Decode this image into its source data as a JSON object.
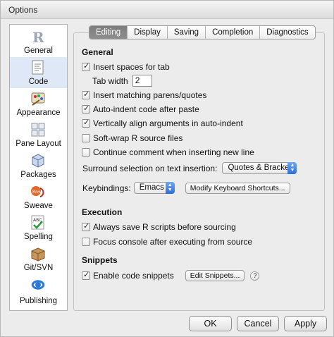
{
  "window": {
    "title": "Options"
  },
  "sidebar": {
    "items": [
      {
        "label": "General",
        "icon": "r-logo-icon"
      },
      {
        "label": "Code",
        "icon": "code-document-icon"
      },
      {
        "label": "Appearance",
        "icon": "paint-palette-icon"
      },
      {
        "label": "Pane Layout",
        "icon": "pane-layout-icon"
      },
      {
        "label": "Packages",
        "icon": "packages-icon"
      },
      {
        "label": "Sweave",
        "icon": "sweave-pdf-icon"
      },
      {
        "label": "Spelling",
        "icon": "spellcheck-abc-icon"
      },
      {
        "label": "Git/SVN",
        "icon": "git-box-icon"
      },
      {
        "label": "Publishing",
        "icon": "publishing-icon"
      }
    ],
    "selected": "Code"
  },
  "tabs": [
    "Editing",
    "Display",
    "Saving",
    "Completion",
    "Diagnostics"
  ],
  "active_tab": "Editing",
  "general": {
    "heading": "General",
    "insert_spaces": "Insert spaces for tab",
    "tab_width_label": "Tab width",
    "tab_width_value": "2",
    "matching_parens": "Insert matching parens/quotes",
    "auto_indent": "Auto-indent code after paste",
    "vertically_align": "Vertically align arguments in auto-indent",
    "soft_wrap": "Soft-wrap R source files",
    "continue_comment": "Continue comment when inserting new line",
    "surround_label": "Surround selection on text insertion:",
    "surround_value": "Quotes & Brackets",
    "keybindings_label": "Keybindings:",
    "keybindings_value": "Emacs",
    "modify_shortcuts": "Modify Keyboard Shortcuts..."
  },
  "execution": {
    "heading": "Execution",
    "always_save": "Always save R scripts before sourcing",
    "focus_console": "Focus console after executing from source"
  },
  "snippets": {
    "heading": "Snippets",
    "enable": "Enable code snippets",
    "edit_button": "Edit Snippets...",
    "help": "?"
  },
  "buttons": {
    "ok": "OK",
    "cancel": "Cancel",
    "apply": "Apply"
  },
  "colors": {
    "selected_sidebar": "#dfe8f6",
    "active_tab": "#858585",
    "popup_arrow": "#3d7fe0"
  }
}
